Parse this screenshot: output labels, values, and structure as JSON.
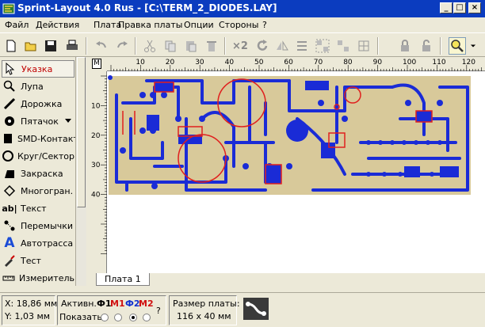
{
  "window": {
    "title": "Sprint-Layout 4.0 Rus - [C:\\TERM_2_DIODES.LAY]",
    "controls": [
      "_",
      "□",
      "×"
    ]
  },
  "menu": [
    "Файл",
    "Действия",
    "Плата",
    "Правка платы",
    "Опции",
    "Стороны",
    "?"
  ],
  "toolbar": {
    "zoom_label": "×2",
    "icons": [
      "new-icon",
      "open-icon",
      "save-icon",
      "print-icon",
      "undo-icon",
      "redo-icon",
      "cut-icon",
      "copy-icon",
      "paste-icon",
      "delete-icon",
      "zoom-x2-icon",
      "rotate-icon",
      "mirror-icon",
      "align-icon",
      "group-icon",
      "ungroup-icon",
      "lock-icon",
      "unlock-icon",
      "zoom-icon"
    ]
  },
  "palette": {
    "active_index": 0,
    "items": [
      {
        "label": "Указка",
        "icon": "pointer-icon"
      },
      {
        "label": "Лупа",
        "icon": "magnifier-icon"
      },
      {
        "label": "Дорожка",
        "icon": "track-icon"
      },
      {
        "label": "Пятачок",
        "icon": "pad-icon"
      },
      {
        "label": "SMD-Контакт",
        "icon": "smd-pad-icon"
      },
      {
        "label": "Круг/Сектор",
        "icon": "circle-icon"
      },
      {
        "label": "Закраска",
        "icon": "fill-icon"
      },
      {
        "label": "Многогран.",
        "icon": "polygon-icon"
      },
      {
        "label": "Текст",
        "icon": "text-icon"
      },
      {
        "label": "Перемычки",
        "icon": "jumper-icon"
      },
      {
        "label": "Автотрасса",
        "icon": "autoroute-icon"
      },
      {
        "label": "Тест",
        "icon": "test-icon"
      },
      {
        "label": "Измеритель",
        "icon": "ruler-icon"
      }
    ]
  },
  "rulers": {
    "corner": "M",
    "h_ticks": [
      "10",
      "20",
      "30",
      "40",
      "50",
      "60",
      "70",
      "80",
      "90",
      "100",
      "110",
      "120"
    ],
    "v_ticks": [
      "10",
      "20",
      "30",
      "40"
    ]
  },
  "board": {
    "color": "#d8c99a",
    "track_color": "#1a2bd6",
    "silk_color": "#e0201e"
  },
  "tabs": [
    "Плата 1"
  ],
  "status": {
    "x": "X: 18,86 мм",
    "y": "Y: 1,03 мм",
    "active_label": "Активн.",
    "layers": [
      {
        "label": "Ф1",
        "color": "#000000"
      },
      {
        "label": "М1",
        "color": "#d01010"
      },
      {
        "label": "Ф2",
        "color": "#1030d0"
      },
      {
        "label": "М2",
        "color": "#d01010"
      }
    ],
    "show_label": "Показать",
    "show_radios": [
      false,
      false,
      true,
      false
    ],
    "help": "?",
    "size_label": "Размер платы:",
    "size_value": "116 x 40 мм"
  }
}
